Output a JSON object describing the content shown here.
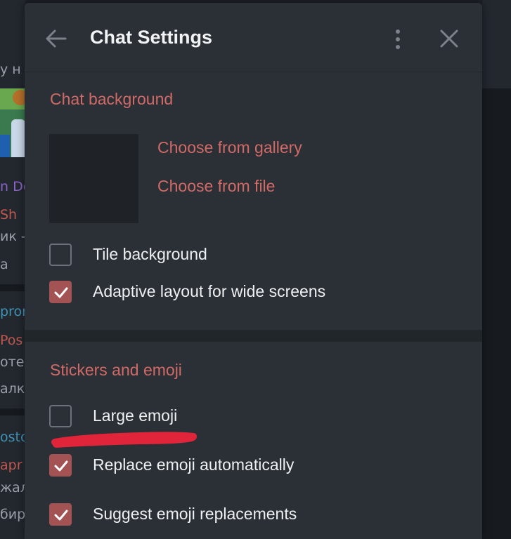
{
  "colors": {
    "accent": "#d16a66",
    "checkbox_checked": "#a35353",
    "dialog_bg": "#2b2f36",
    "text": "#eef0f2",
    "annotation": "#e0243a"
  },
  "background_list": {
    "items": [
      {
        "text": "у н",
        "color": "#9aa0a8"
      },
      {
        "text": "n Do",
        "color": "#8a63c9"
      },
      {
        "text": "Sh",
        "color": "#c0584f"
      },
      {
        "text": "ик -",
        "color": "#9aa0a8"
      },
      {
        "text": "а",
        "color": "#9aa0a8"
      },
      {
        "text": "pror",
        "color": "#3f93b8"
      },
      {
        "text": "Pos",
        "color": "#c0584f"
      },
      {
        "text": "отен",
        "color": "#9aa0a8"
      },
      {
        "text": "алко",
        "color": "#9aa0a8"
      },
      {
        "text": "osto",
        "color": "#3f93b8"
      },
      {
        "text": "apr",
        "color": "#c0584f"
      },
      {
        "text": "жал",
        "color": "#9aa0a8"
      },
      {
        "text": "бир",
        "color": "#9aa0a8"
      }
    ]
  },
  "header": {
    "back_icon": "arrow-left-icon",
    "title": "Chat Settings",
    "menu_icon": "more-vertical-icon",
    "close_icon": "close-icon"
  },
  "chat_background": {
    "title": "Chat background",
    "choose_gallery": "Choose from gallery",
    "choose_file": "Choose from file",
    "options": [
      {
        "label": "Tile background",
        "checked": false
      },
      {
        "label": "Adaptive layout for wide screens",
        "checked": true
      }
    ]
  },
  "stickers": {
    "title": "Stickers and emoji",
    "options": [
      {
        "label": "Large emoji",
        "checked": false
      },
      {
        "label": "Replace emoji automatically",
        "checked": true
      },
      {
        "label": "Suggest emoji replacements",
        "checked": true
      }
    ]
  }
}
